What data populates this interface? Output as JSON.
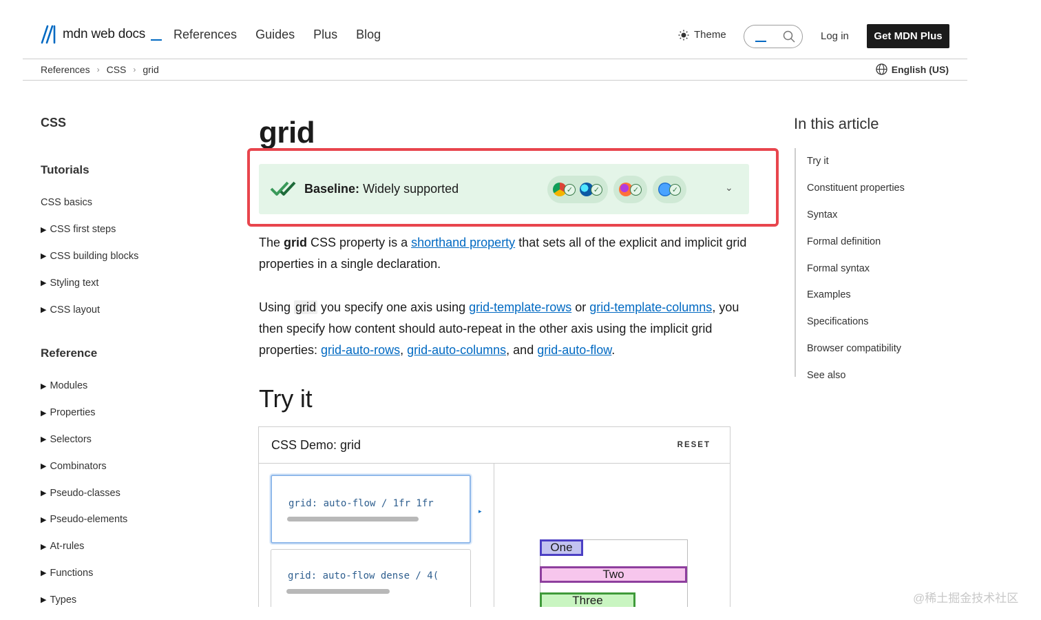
{
  "header": {
    "logo_text": "mdn web docs",
    "nav": [
      "References",
      "Guides",
      "Plus",
      "Blog"
    ],
    "theme_label": "Theme",
    "login_label": "Log in",
    "cta_label": "Get MDN Plus"
  },
  "breadcrumb": {
    "items": [
      "References",
      "CSS",
      "grid"
    ],
    "language": "English (US)"
  },
  "sidebar": {
    "title": "CSS",
    "sections": [
      {
        "heading": "Tutorials",
        "items": [
          {
            "label": "CSS basics",
            "expandable": false
          },
          {
            "label": "CSS first steps",
            "expandable": true
          },
          {
            "label": "CSS building blocks",
            "expandable": true
          },
          {
            "label": "Styling text",
            "expandable": true
          },
          {
            "label": "CSS layout",
            "expandable": true
          }
        ]
      },
      {
        "heading": "Reference",
        "items": [
          {
            "label": "Modules",
            "expandable": true
          },
          {
            "label": "Properties",
            "expandable": true
          },
          {
            "label": "Selectors",
            "expandable": true
          },
          {
            "label": "Combinators",
            "expandable": true
          },
          {
            "label": "Pseudo-classes",
            "expandable": true
          },
          {
            "label": "Pseudo-elements",
            "expandable": true
          },
          {
            "label": "At-rules",
            "expandable": true
          },
          {
            "label": "Functions",
            "expandable": true
          },
          {
            "label": "Types",
            "expandable": true
          }
        ]
      }
    ]
  },
  "article": {
    "title": "grid",
    "baseline": {
      "label": "Baseline:",
      "status": "Widely supported"
    },
    "browsers": [
      "chrome-icon",
      "edge-icon",
      "firefox-icon",
      "safari-icon"
    ],
    "para1": {
      "t1": "The ",
      "b1": "grid",
      "t2": " CSS property is a ",
      "link1": "shorthand property",
      "t3": " that sets all of the explicit and implicit grid properties in a single declaration."
    },
    "para2": {
      "t1": "Using ",
      "code1": "grid",
      "t2": " you specify one axis using ",
      "link1": "grid-template-rows",
      "t3": " or ",
      "link2": "grid-template-columns",
      "t4": ", you then specify how content should auto-repeat in the other axis using the implicit grid properties: ",
      "link3": "grid-auto-rows",
      "t5": ", ",
      "link4": "grid-auto-columns",
      "t6": ", and ",
      "link5": "grid-auto-flow",
      "t7": "."
    },
    "try_heading": "Try it",
    "demo": {
      "title": "CSS Demo: grid",
      "reset": "RESET",
      "options": [
        "grid: auto-flow / 1fr 1fr",
        "grid: auto-flow dense / 4("
      ],
      "output_items": [
        "One",
        "Two",
        "Three"
      ]
    }
  },
  "toc": {
    "title": "In this article",
    "items": [
      "Try it",
      "Constituent properties",
      "Syntax",
      "Formal definition",
      "Formal syntax",
      "Examples",
      "Specifications",
      "Browser compatibility",
      "See also"
    ]
  },
  "watermark": "@稀土掘金技术社区",
  "colors": {
    "accent": "#0069c2",
    "highlight_border": "#e8454d",
    "baseline_bg": "#e4f5e8"
  }
}
